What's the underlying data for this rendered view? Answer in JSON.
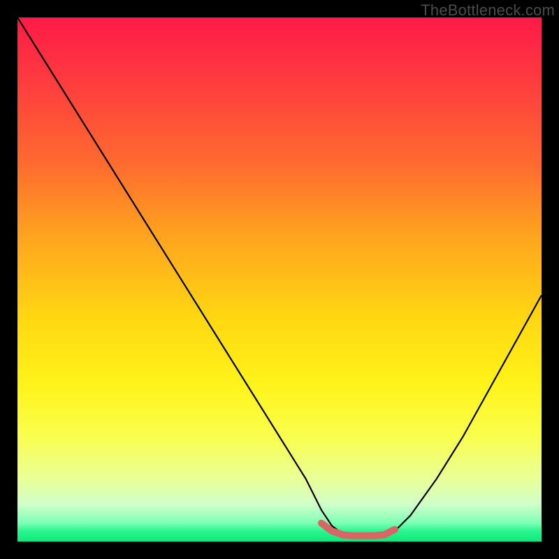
{
  "watermark": "TheBottleneck.com",
  "chart_data": {
    "type": "line",
    "title": "",
    "xlabel": "",
    "ylabel": "",
    "xlim": [
      0,
      100
    ],
    "ylim": [
      0,
      100
    ],
    "series": [
      {
        "name": "bottleneck-curve",
        "color": "#000000",
        "x": [
          0,
          5,
          10,
          15,
          20,
          25,
          30,
          35,
          40,
          45,
          50,
          55,
          58,
          60,
          62,
          64,
          66,
          68,
          70,
          72,
          75,
          80,
          85,
          90,
          95,
          100
        ],
        "y": [
          100,
          92,
          84,
          76,
          68,
          60,
          52,
          44,
          36,
          28,
          20,
          12,
          6,
          3,
          1.5,
          1,
          1,
          1,
          1.2,
          2,
          5,
          12,
          20,
          29,
          38,
          47
        ]
      },
      {
        "name": "optimal-range-marker",
        "color": "#d96666",
        "x": [
          58,
          60,
          62,
          64,
          66,
          68,
          70,
          72
        ],
        "y": [
          3.5,
          2.0,
          1.3,
          1.1,
          1.1,
          1.1,
          1.3,
          2.3
        ]
      }
    ],
    "background_gradient": {
      "top": "#ff1a47",
      "mid": "#ffe714",
      "bottom": "#11e77e"
    }
  }
}
